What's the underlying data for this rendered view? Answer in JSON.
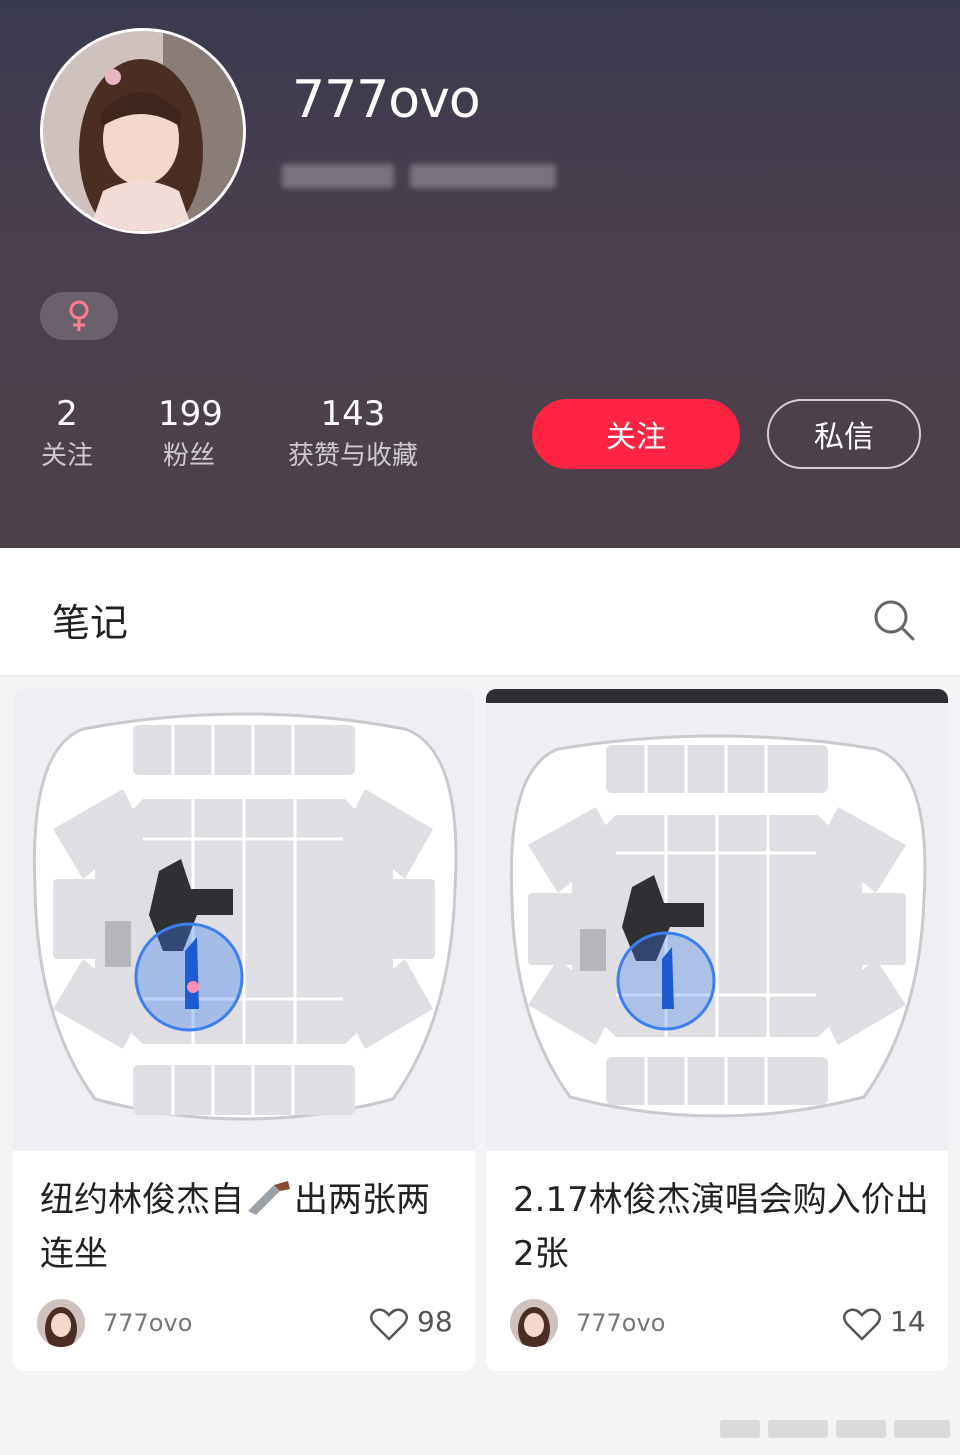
{
  "profile": {
    "username": "777ovo",
    "gender_icon": "female-symbol-icon",
    "stats": [
      {
        "value": "2",
        "label": "关注"
      },
      {
        "value": "199",
        "label": "粉丝"
      },
      {
        "value": "143",
        "label": "获赞与收藏"
      }
    ],
    "follow_label": "关注",
    "message_label": "私信"
  },
  "tabs": {
    "notes_title": "笔记",
    "search_icon": "search-icon"
  },
  "cards": [
    {
      "title": "纽约林俊杰自",
      "title_after_icon": "出两张两连坐",
      "inline_icon": "knife-emoji-icon",
      "author": "777ovo",
      "likes": "98"
    },
    {
      "title": "2.17林俊杰演唱会购入价出2张",
      "author": "777ovo",
      "likes": "14"
    }
  ],
  "colors": {
    "accent": "#ff2442",
    "header_bg": "#3a3a4e",
    "highlight": "#3d7ff0"
  }
}
